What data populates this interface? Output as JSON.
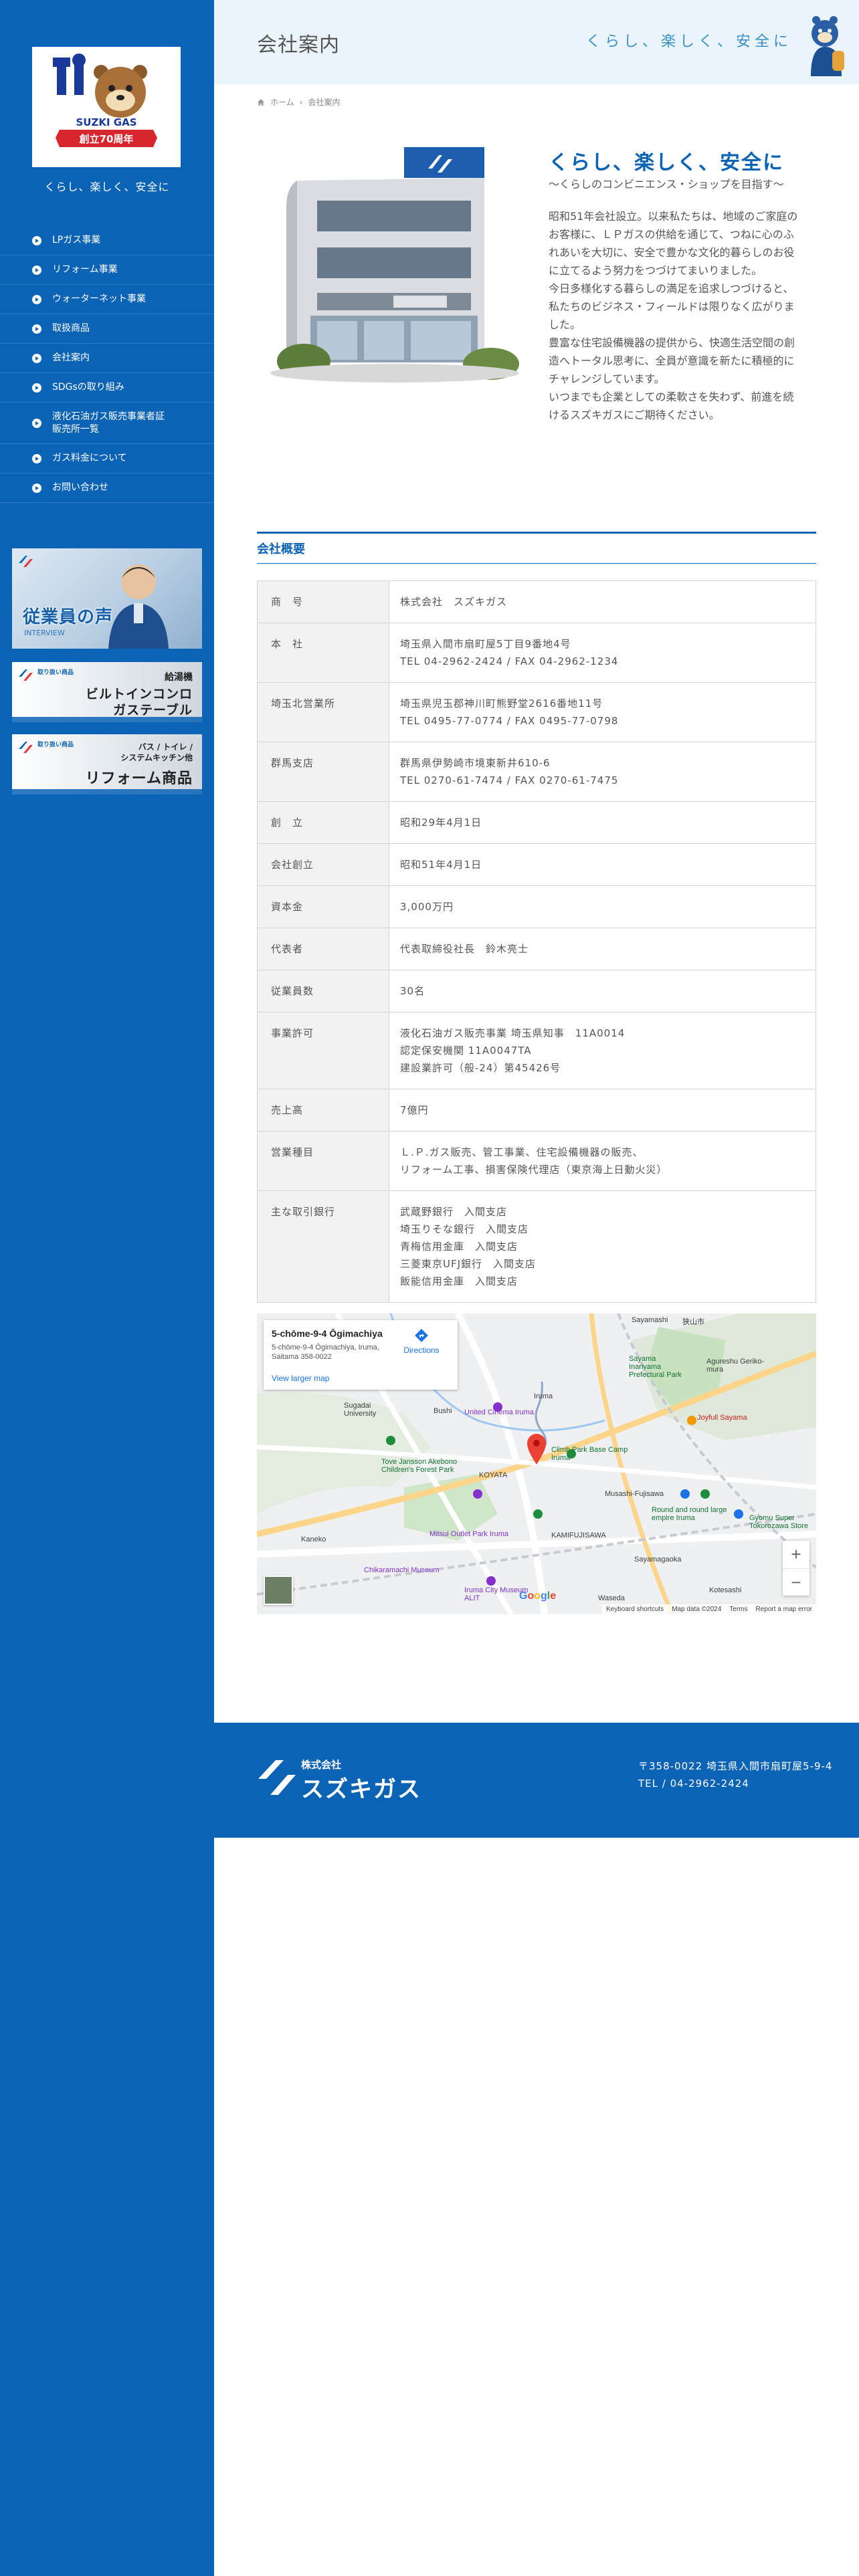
{
  "sidebar": {
    "logo": {
      "brand": "SUZKI GAS",
      "ribbon": "創立70周年"
    },
    "tagline": "くらし、楽しく、安全に",
    "nav": [
      {
        "label": "LPガス事業"
      },
      {
        "label": "リフォーム事業"
      },
      {
        "label": "ウォーターネット事業"
      },
      {
        "label": "取扱商品"
      },
      {
        "label": "会社案内"
      },
      {
        "label": "SDGsの取り組み"
      },
      {
        "label": "液化石油ガス販売事業者証\n販売所一覧"
      },
      {
        "label": "ガス料金について"
      },
      {
        "label": "お問い合わせ"
      }
    ],
    "banners": {
      "voice": {
        "title": "従業員の声",
        "sub": "INTERVIEW"
      },
      "builtin": {
        "tag": "取り扱い商品",
        "line1": "給湯機",
        "line2": "ビルトインコンロ\nガステーブル"
      },
      "reform": {
        "tag": "取り扱い商品",
        "line1": "バス / トイレ /\nシステムキッチン他",
        "line2": "リフォーム商品"
      }
    }
  },
  "header": {
    "title": "会社案内",
    "slogan": "くらし、楽しく、安全に",
    "breadcrumb": {
      "home": "ホーム",
      "separator": "›",
      "current": "会社案内"
    }
  },
  "intro": {
    "heading": "くらし、楽しく、安全に",
    "subheading": "〜くらしのコンビニエンス・ショップを目指す〜",
    "body": "昭和51年会社設立。以来私たちは、地域のご家庭の\nお客様に、ＬＰガスの供給を通じて、つねに心のふ\nれあいを大切に、安全で豊かな文化的暮らしのお役\nに立てるよう努力をつづけてまいりました。\n今日多様化する暮らしの満足を追求しつづけると、\n私たちのビジネス・フィールドは限りなく広がりま\nした。\n豊富な住宅設備機器の提供から、快適生活空間の創\n造へトータル思考に、全員が意識を新たに積極的に\nチャレンジしています。\nいつまでも企業としての柔軟さを失わず、前進を続\nけるスズキガスにご期待ください。"
  },
  "overview": {
    "title": "会社概要",
    "rows": [
      {
        "key": "商　号",
        "value": "株式会社　スズキガス"
      },
      {
        "key": "本　社",
        "value": "埼玉県入間市扇町屋5丁目9番地4号\nTEL 04-2962-2424 / FAX 04-2962-1234"
      },
      {
        "key": "埼玉北営業所",
        "value": "埼玉県児玉郡神川町熊野堂2616番地11号\nTEL 0495-77-0774 / FAX 0495-77-0798"
      },
      {
        "key": "群馬支店",
        "value": "群馬県伊勢崎市境東新井610-6\nTEL 0270-61-7474 / FAX 0270-61-7475"
      },
      {
        "key": "創　立",
        "value": "昭和29年4月1日"
      },
      {
        "key": "会社創立",
        "value": "昭和51年4月1日"
      },
      {
        "key": "資本金",
        "value": "3,000万円"
      },
      {
        "key": "代表者",
        "value": "代表取締役社長　鈴木亮士"
      },
      {
        "key": "従業員数",
        "value": "30名"
      },
      {
        "key": "事業許可",
        "value": "液化石油ガス販売事業 埼玉県知事　11A0014\n認定保安機関 11A0047TA\n建設業許可（般-24）第45426号"
      },
      {
        "key": "売上高",
        "value": "7億円"
      },
      {
        "key": "営業種目",
        "value": "Ｌ.Ｐ.ガス販売、管工事業、住宅設備機器の販売、\nリフォーム工事、損害保険代理店（東京海上日動火災）"
      },
      {
        "key": "主な取引銀行",
        "value": "武蔵野銀行　入間支店\n埼玉りそな銀行　入間支店\n青梅信用金庫　入間支店\n三菱東京UFJ銀行　入間支店\n飯能信用金庫　入間支店"
      }
    ]
  },
  "map": {
    "card_title": "5-chōme-9-4 Ōgimachiya",
    "card_address": "5-chōme-9-4 Ōgimachiya, Iruma, Saitama 358-0022",
    "larger_map": "View larger map",
    "directions": "Directions",
    "zoom_in": "+",
    "zoom_out": "−",
    "attribution": [
      "Keyboard shortcuts",
      "Map data ©2024",
      "Terms",
      "Report a map error"
    ],
    "google": "Google",
    "places": [
      {
        "name": "Sayamashi",
        "c": ""
      },
      {
        "name": "狭山市",
        "c": ""
      },
      {
        "name": "Sayama Inariyama Prefectural Park",
        "c": "g"
      },
      {
        "name": "Agureshu Geriko-mura",
        "c": ""
      },
      {
        "name": "Joyfull Sayama",
        "c": "o"
      },
      {
        "name": "Iruma",
        "c": ""
      },
      {
        "name": "Bushi",
        "c": ""
      },
      {
        "name": "Sugadai University",
        "c": ""
      },
      {
        "name": "United Cinema Iruma",
        "c": "p"
      },
      {
        "name": "Climb Park Base Camp Iruma",
        "c": "g"
      },
      {
        "name": "Tove Jansson Akebono Children's Forest Park",
        "c": "g"
      },
      {
        "name": "KOYATA",
        "c": ""
      },
      {
        "name": "Musashi-Fujisawa",
        "c": ""
      },
      {
        "name": "Round and round large empire Iruma",
        "c": "g"
      },
      {
        "name": "Kaneko",
        "c": ""
      },
      {
        "name": "Mitsui Outlet Park Iruma",
        "c": "p"
      },
      {
        "name": "KAMIFUJISAWA",
        "c": ""
      },
      {
        "name": "Gyomu Super Tokorozawa Store",
        "c": "g"
      },
      {
        "name": "Sayamagaoka",
        "c": ""
      },
      {
        "name": "Chikaramachi Museum",
        "c": "p"
      },
      {
        "name": "Iruma City Museum ALIT",
        "c": "p"
      },
      {
        "name": "Kotesashi",
        "c": ""
      },
      {
        "name": "Waseda",
        "c": ""
      }
    ]
  },
  "footer": {
    "company_small": "株式会社",
    "company": "スズキガス",
    "address": "〒358-0022 埼玉県入間市扇町屋5-9-4",
    "tel": "TEL / 04-2962-2424"
  },
  "colors": {
    "brand_blue": "#0a63b5",
    "header_bg": "#eaf4fb",
    "accent_text": "#3a90c7"
  }
}
